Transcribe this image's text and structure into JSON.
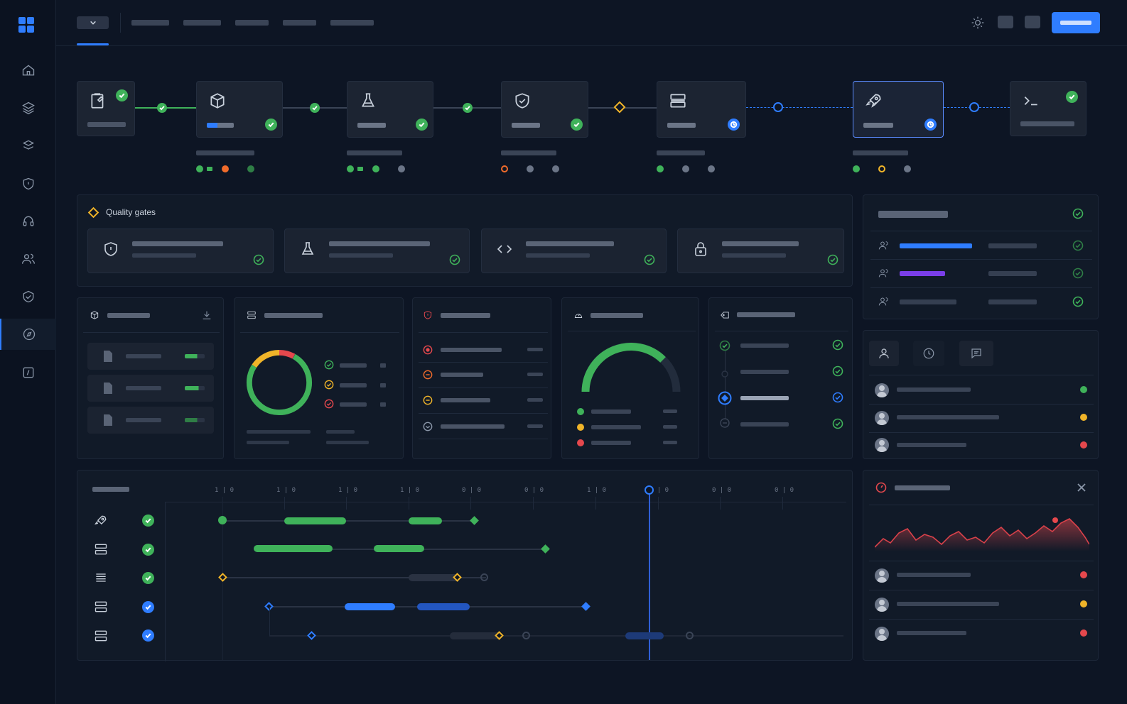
{
  "quality_gates": {
    "title": "Quality gates"
  },
  "colors": {
    "accent": "#2f7dff",
    "success": "#3fb25a",
    "warning": "#f0b429",
    "error": "#e5484d",
    "running": "#2f7dff",
    "purple": "#7a3ee8"
  },
  "icons": {
    "sidebar": [
      "home-icon",
      "layers-icon",
      "stack-icon",
      "shield-icon",
      "headset-icon",
      "users-icon",
      "shield-check-icon",
      "compass-icon",
      "terminal-square-icon"
    ],
    "stages": [
      "clipboard-icon",
      "package-icon",
      "flask-icon",
      "shield-icon",
      "server-icon",
      "rocket-icon",
      "terminal-icon"
    ],
    "gates": [
      "shield-icon",
      "flask-icon",
      "code-icon",
      "lock-icon"
    ],
    "tabs": [
      "user-icon",
      "clock-icon",
      "message-icon"
    ]
  },
  "pipeline": {
    "stages": [
      {
        "status": "success"
      },
      {
        "status": "success"
      },
      {
        "status": "success"
      },
      {
        "status": "success"
      },
      {
        "status": "running"
      },
      {
        "status": "running",
        "selected": true
      },
      {
        "status": "success"
      }
    ]
  },
  "progress": {
    "build_artifacts": [
      0.62,
      0.7,
      0.62
    ],
    "gauge_fraction": 0.66,
    "donut_segments": [
      0.76,
      0.16,
      0.08
    ]
  },
  "gantt": {
    "ticks": [
      "1 | 0",
      "1 | 0",
      "1 | 0",
      "1 | 0",
      "0 | 0",
      "0 | 0",
      "1 | 0",
      "0 | 0",
      "0 | 0",
      "0 | 0"
    ],
    "rows": [
      {
        "icon": "rocket-icon",
        "status": "success"
      },
      {
        "icon": "server-icon",
        "status": "success"
      },
      {
        "icon": "list-icon",
        "status": "success"
      },
      {
        "icon": "server-icon",
        "status": "running"
      },
      {
        "icon": "server-icon",
        "status": "running"
      }
    ]
  }
}
